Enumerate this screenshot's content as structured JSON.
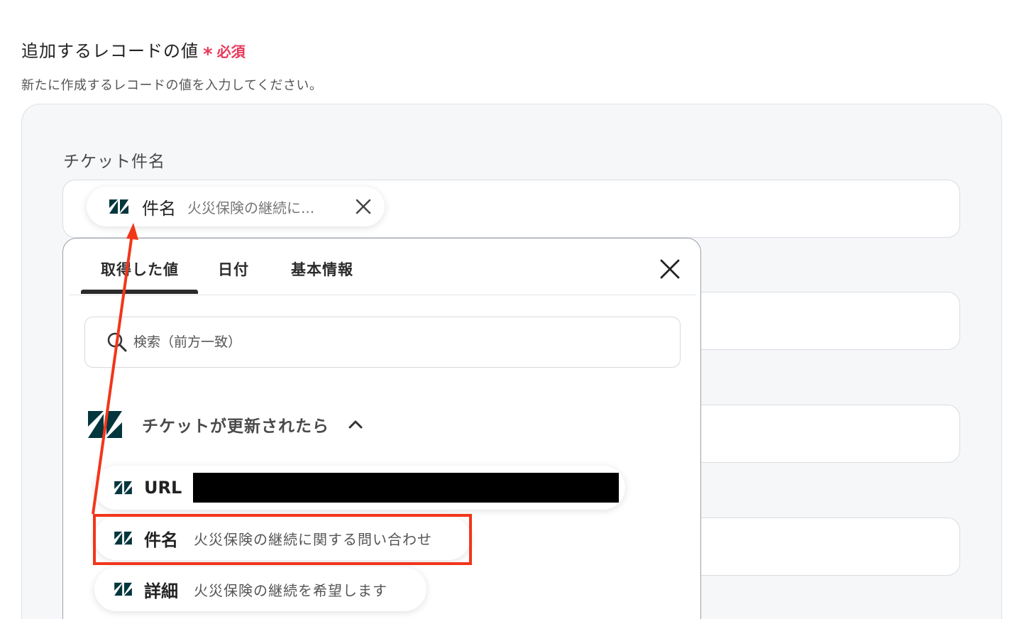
{
  "section": {
    "title": "追加するレコードの値",
    "asterisk": "*",
    "required": "必須",
    "description": "新たに作成するレコードの値を入力してください。"
  },
  "field": {
    "label": "チケット件名"
  },
  "chip": {
    "key": "件名",
    "value": "火災保険の継続に..."
  },
  "popup": {
    "tabs": [
      {
        "label": "取得した値",
        "active": true
      },
      {
        "label": "日付",
        "active": false
      },
      {
        "label": "基本情報",
        "active": false
      }
    ],
    "search_placeholder": "検索（前方一致）",
    "group": {
      "title": "チケットが更新されたら",
      "icon": "zendesk-icon",
      "expanded": true
    },
    "items": [
      {
        "key": "URL",
        "value": ""
      },
      {
        "key": "件名",
        "value": "火災保険の継続に関する問い合わせ"
      },
      {
        "key": "詳細",
        "value": "火災保険の継続を希望します"
      }
    ]
  },
  "colors": {
    "required": "#e8385a",
    "zendesk": "#03363d",
    "annotation": "#f2361a"
  }
}
